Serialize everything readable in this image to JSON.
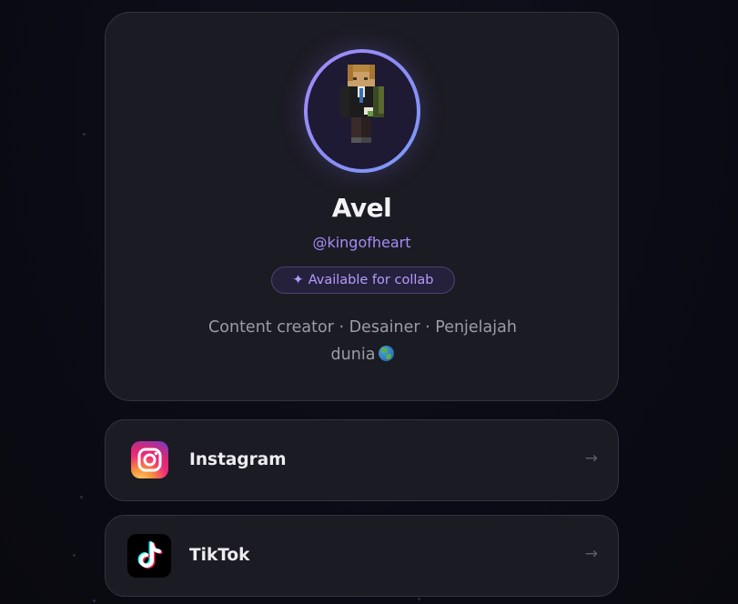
{
  "profile": {
    "name": "Avel",
    "username": "@kingofheart",
    "badge_icon": "✦",
    "badge_label": "Available for collab",
    "bio_line1": "Content creator · Desainer · Penjelajah",
    "bio_line2": "dunia",
    "bio_emoji": "globe-icon"
  },
  "links": [
    {
      "label": "Instagram",
      "icon": "instagram-icon",
      "arrow": "→"
    },
    {
      "label": "TikTok",
      "icon": "tiktok-icon",
      "arrow": "→"
    }
  ],
  "colors": {
    "background": "#0b0b15",
    "card": "#1b1b23",
    "accent": "#a78bfa",
    "text": "#f2f2f5",
    "muted": "#9c9ca6"
  }
}
